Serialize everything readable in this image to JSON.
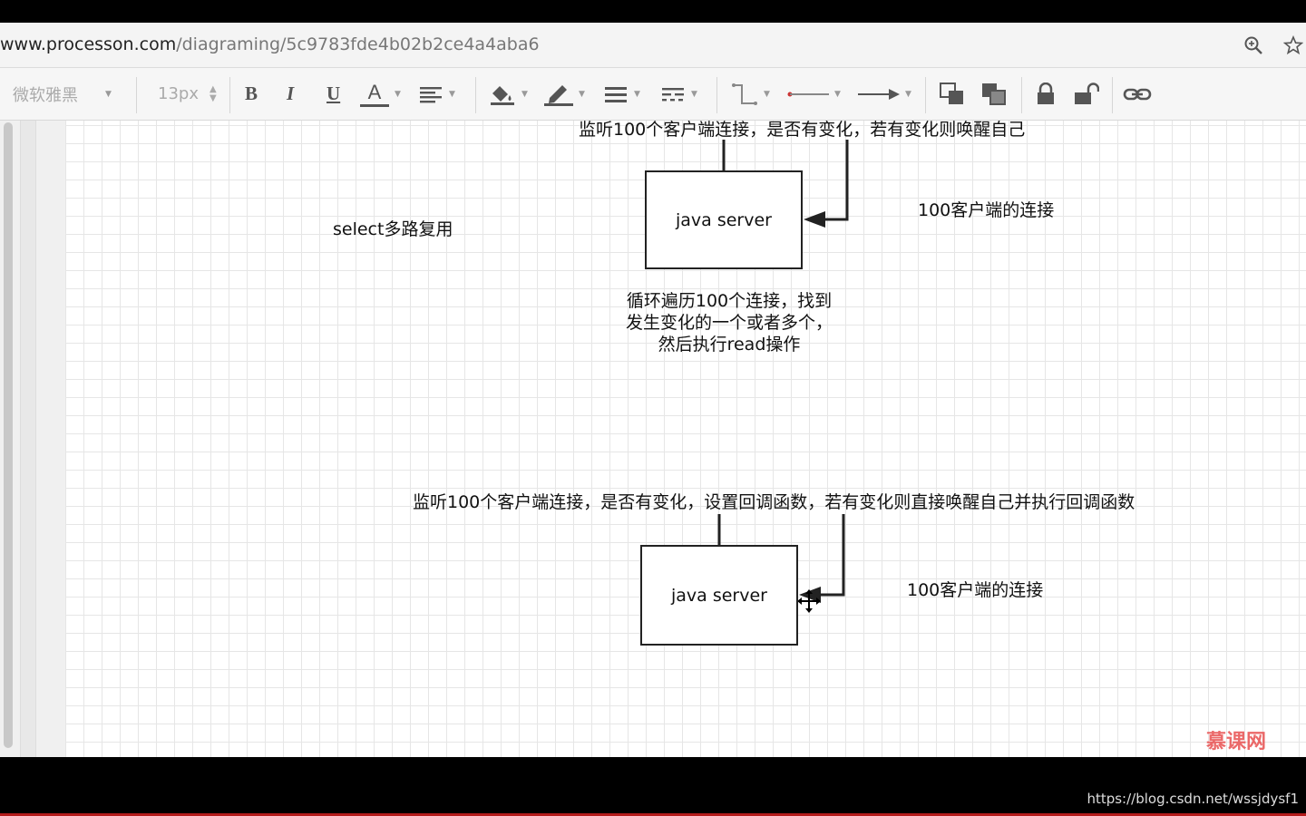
{
  "browser": {
    "url_host": "www.processon.com",
    "url_path": "/diagraming/5c9783fde4b02b2ce4a4aba6",
    "icons": [
      "zoom-icon",
      "bookmark-star-icon"
    ]
  },
  "toolbar": {
    "font_family": "微软雅黑",
    "font_size": "13px",
    "bold_label": "B",
    "italic_label": "I",
    "underline_label": "U",
    "font_color_label": "A",
    "icons": [
      "align-icon",
      "fill-color-icon",
      "line-color-icon",
      "line-width-icon",
      "line-style-icon",
      "connector-icon",
      "line-start-icon",
      "line-end-icon",
      "bring-front-icon",
      "send-back-icon",
      "lock-icon",
      "unlock-icon",
      "link-icon"
    ]
  },
  "diagram": {
    "top": {
      "listen_label": "监听100个客户端连接，是否有变化，若有变化则唤醒自己",
      "server_label": "java server",
      "clients_label": "100客户端的连接",
      "select_label": "select多路复用",
      "loop_lines": [
        "循环遍历100个连接，找到",
        "发生变化的一个或者多个，",
        "然后执行read操作"
      ]
    },
    "bottom": {
      "listen_label": "监听100个客户端连接，是否有变化，设置回调函数，若有变化则直接唤醒自己并执行回调函数",
      "server_label": "java server",
      "clients_label": "100客户端的连接"
    }
  },
  "footer": {
    "watermark": "慕课网",
    "credit": "https://blog.csdn.net/wssjdysf1"
  }
}
